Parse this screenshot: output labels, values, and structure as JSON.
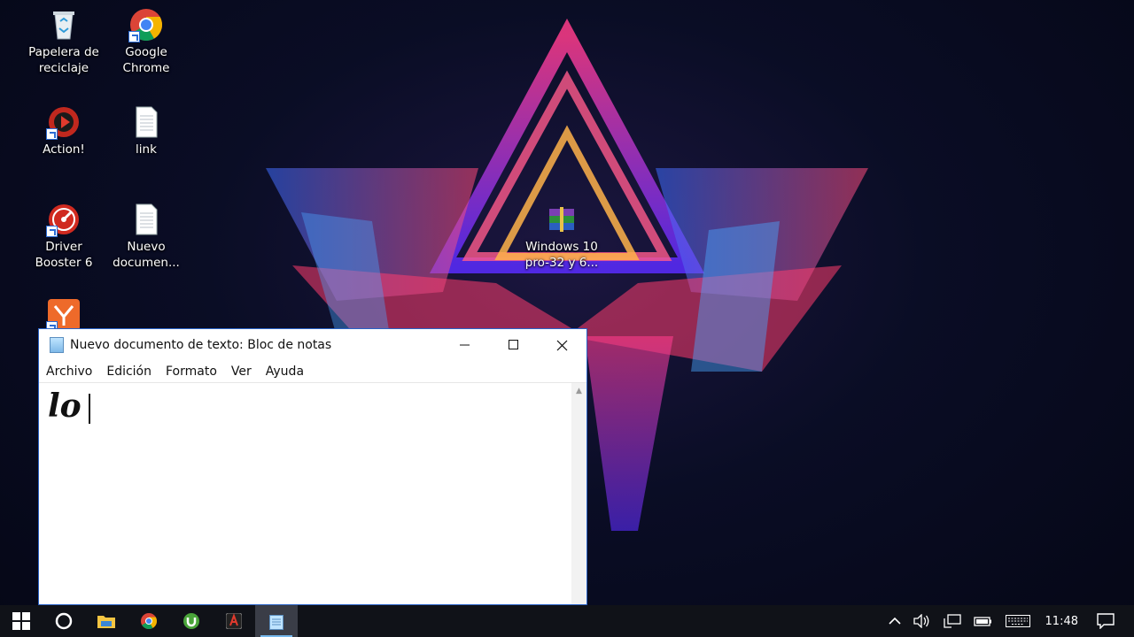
{
  "desktop": {
    "icons": [
      {
        "label": "Papelera de reciclaje",
        "icon": "recycle-bin-icon"
      },
      {
        "label": "Google Chrome",
        "icon": "chrome-icon"
      },
      {
        "label": "Action!",
        "icon": "action-icon"
      },
      {
        "label": "link",
        "icon": "text-file-icon"
      },
      {
        "label": "Driver Booster 6",
        "icon": "driver-booster-icon"
      },
      {
        "label": "Nuevo documen...",
        "icon": "text-file-icon"
      },
      {
        "label": "Windows 10 pro-32 y 6...",
        "icon": "winrar-archive-icon"
      }
    ]
  },
  "notepad": {
    "title": "Nuevo documento de texto: Bloc de notas",
    "menu": [
      "Archivo",
      "Edición",
      "Formato",
      "Ver",
      "Ayuda"
    ],
    "content": "lo"
  },
  "taskbar": {
    "clock": "11:48",
    "apps": [
      "start-icon",
      "cortana-icon",
      "file-explorer-icon",
      "chrome-icon",
      "utorrent-icon",
      "action-icon",
      "notepad-icon"
    ]
  },
  "colors": {
    "accent": "#2a63c7",
    "taskbar": "#101218",
    "active_indicator": "#76b9ed"
  }
}
